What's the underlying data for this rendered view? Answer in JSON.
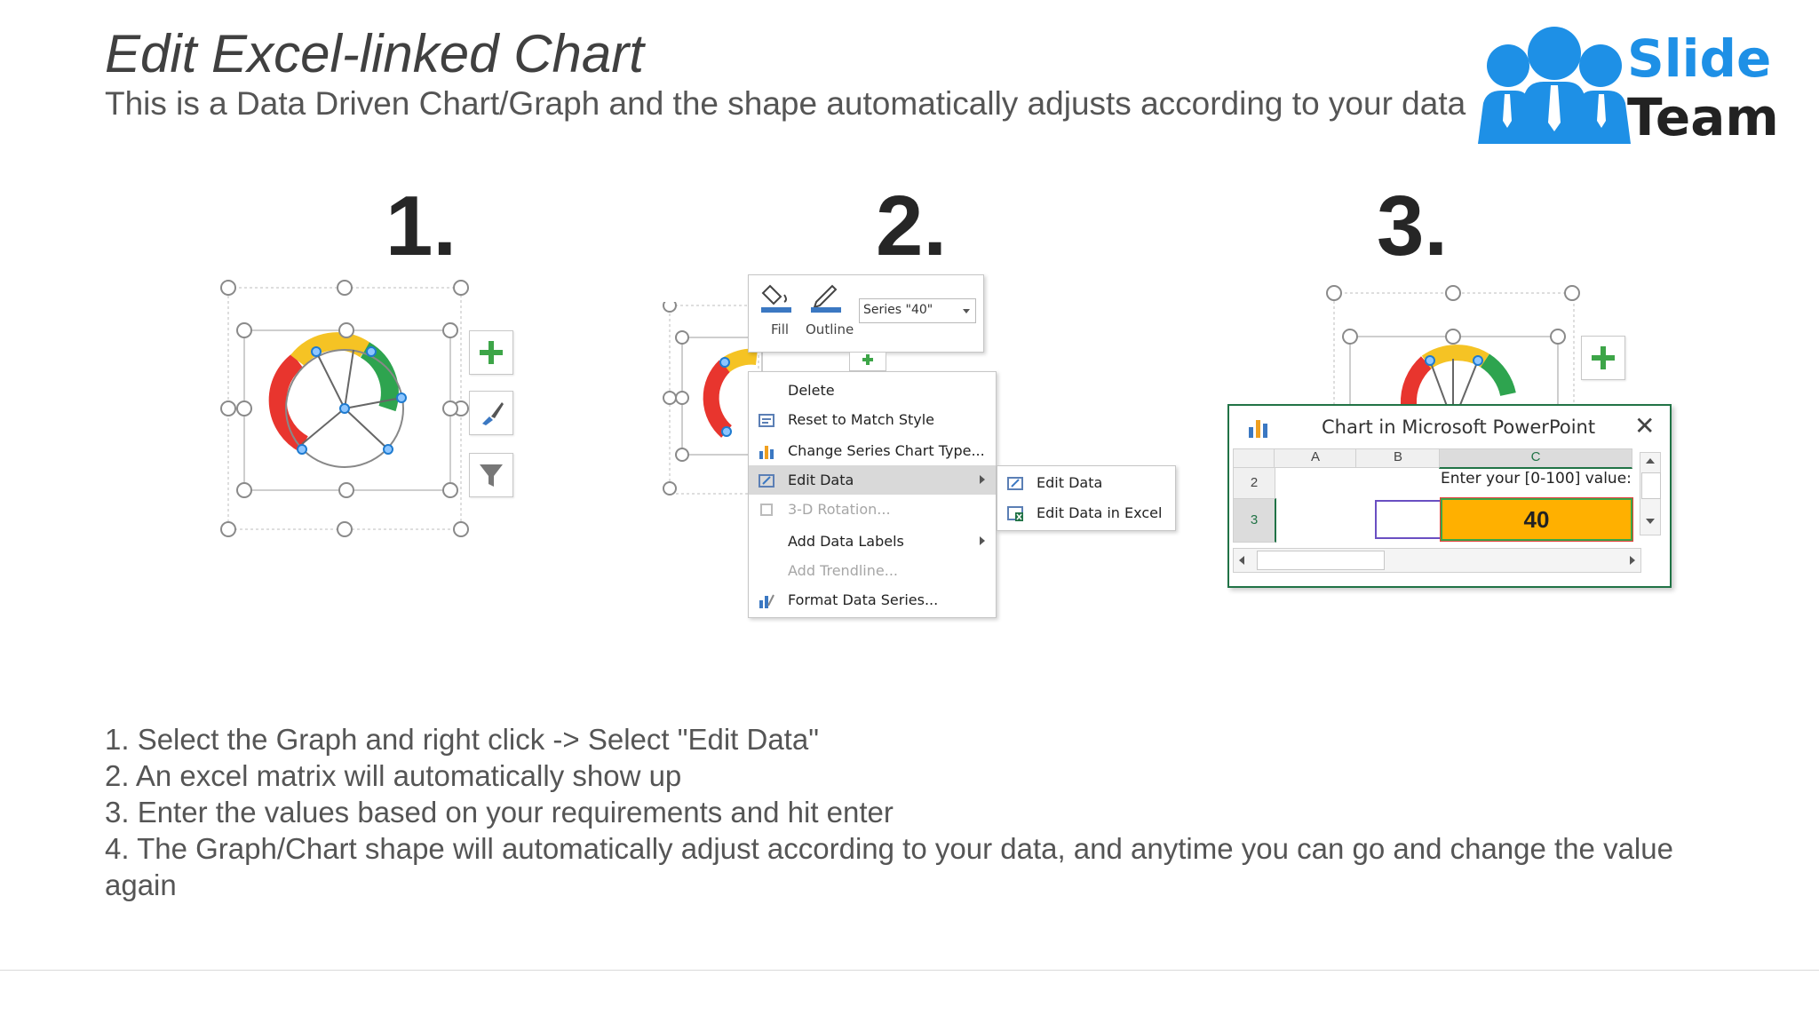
{
  "slide": {
    "title": "Edit Excel-linked Chart",
    "subtitle": "This is a Data Driven Chart/Graph and the shape automatically adjusts according to your data"
  },
  "logo": {
    "line1": "Slide",
    "line2": "Team",
    "accent": "#1e90e6"
  },
  "steps": [
    {
      "number": "1."
    },
    {
      "number": "2."
    },
    {
      "number": "3."
    }
  ],
  "format_toolbar": {
    "fill_label": "Fill",
    "outline_label": "Outline",
    "series_selected": "Series \"40\""
  },
  "context_menu": {
    "items": [
      {
        "label": "Delete",
        "icon": "delete-icon",
        "enabled": true
      },
      {
        "label": "Reset to Match Style",
        "icon": "reset-style-icon",
        "enabled": true
      },
      {
        "label": "Change Series Chart Type...",
        "icon": "chart-type-icon",
        "enabled": true
      },
      {
        "label": "Edit Data",
        "icon": "edit-data-icon",
        "enabled": true,
        "highlighted": true,
        "submenu": true
      },
      {
        "label": "3-D Rotation...",
        "icon": "rotation-icon",
        "enabled": false
      },
      {
        "label": "Add Data Labels",
        "icon": "",
        "enabled": true,
        "submenu": true
      },
      {
        "label": "Add Trendline...",
        "icon": "",
        "enabled": false
      },
      {
        "label": "Format Data Series...",
        "icon": "format-series-icon",
        "enabled": true
      }
    ],
    "submenu": [
      {
        "label": "Edit Data",
        "icon": "edit-data-icon"
      },
      {
        "label": "Edit Data in Excel",
        "icon": "excel-icon"
      }
    ]
  },
  "excel_window": {
    "title": "Chart in Microsoft PowerPoint",
    "columns": [
      "A",
      "B",
      "C"
    ],
    "rows": [
      "2",
      "3"
    ],
    "prompt": "Enter your [0-100] value:",
    "value": "40",
    "value_fill": "#ffb000"
  },
  "gauge_colors": {
    "red": "#e8352e",
    "yellow": "#f5c324",
    "green": "#2ea44f"
  },
  "instructions": [
    "1. Select the Graph and right click -> Select \"Edit Data\"",
    "2. An excel matrix will automatically show up",
    "3. Enter the values based on your requirements and hit enter",
    "4. The Graph/Chart shape will automatically adjust according to your data, and anytime you can go and change the value",
    "again"
  ]
}
